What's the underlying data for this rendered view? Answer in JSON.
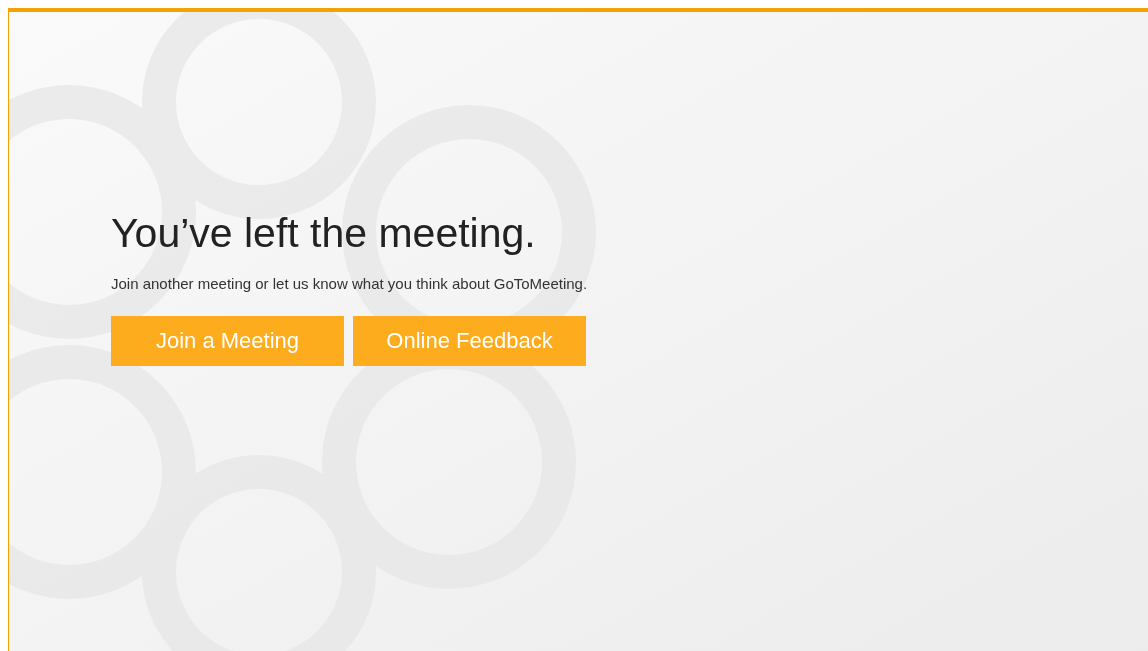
{
  "heading": "You’ve left the meeting.",
  "message": "Join another meeting or let us know what you think about GoToMeeting.",
  "buttons": [
    {
      "label": "Join a Meeting"
    },
    {
      "label": "Online Feedback"
    }
  ]
}
